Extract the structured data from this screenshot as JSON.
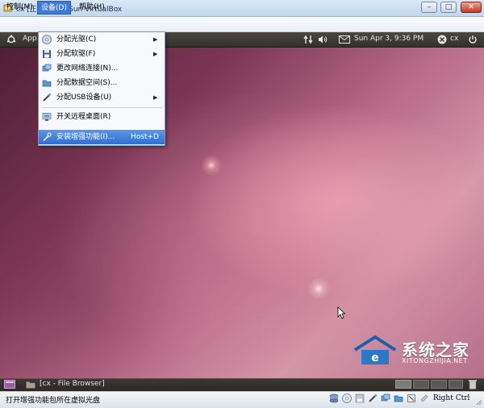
{
  "window": {
    "title": "cx [正在运行] - Sun VirtualBox",
    "minimize_label": "–",
    "maximize_label": "□",
    "close_label": "✕"
  },
  "menubar": {
    "items": [
      {
        "label": "控制(M)"
      },
      {
        "label": "设备(D)"
      },
      {
        "label": "帮助(H)"
      }
    ]
  },
  "devices_menu": {
    "items": [
      {
        "label": "分配光驱(C)",
        "icon": "cd-icon",
        "submenu": true
      },
      {
        "label": "分配软驱(F)",
        "icon": "floppy-icon",
        "submenu": true
      },
      {
        "label": "更改网络连接(N)...",
        "icon": "network-adapter-icon",
        "submenu": false
      },
      {
        "label": "分配数据空间(S)...",
        "icon": "shared-folder-icon",
        "submenu": false
      },
      {
        "label": "分配USB设备(U)",
        "icon": "usb-icon",
        "submenu": true
      },
      {
        "label": "开关远程桌面(R)",
        "icon": "remote-desktop-icon",
        "submenu": false
      },
      {
        "label": "安装增强功能(I)...",
        "icon": "wrench-icon",
        "submenu": false,
        "shortcut": "Host+D",
        "highlighted": true
      }
    ]
  },
  "guest": {
    "top_panel": {
      "applications_label": "App",
      "clock": "Sun Apr  3,  9:36 PM",
      "user": "cx"
    },
    "taskbar": {
      "task_label": "[cx - File Browser]"
    }
  },
  "statusbar": {
    "text": "打开增强功能包所在虚拟光盘",
    "host_key": "Right Ctrl"
  },
  "watermark": {
    "text": "系统之家",
    "url": "XITONGZHIJIA.NET"
  },
  "colors": {
    "menu_highlight": "#2f6fcf",
    "desktop_dark": "#4c1d33",
    "desktop_light": "#d497aa"
  }
}
